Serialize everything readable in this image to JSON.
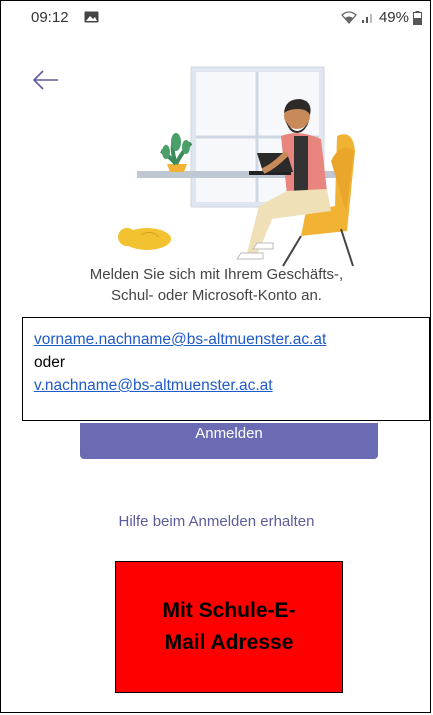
{
  "status_bar": {
    "time": "09:12",
    "battery": "49%",
    "icons": [
      "image-icon",
      "wifi-icon",
      "signal-icon",
      "battery-icon"
    ]
  },
  "screen": {
    "instruction_line1": "Melden Sie sich mit Ihrem Geschäfts-,",
    "instruction_line2": "Schul- oder Microsoft-Konto an.",
    "sign_in_button": "Anmelden",
    "help_link": "Hilfe beim Anmelden erhalten"
  },
  "callout": {
    "email_full": "vorname.nachname@bs-altmuenster.ac.at",
    "or_text": "oder",
    "email_short": "v.nachname@bs-altmuenster.ac.at"
  },
  "note_box": {
    "text": "Mit Schule-E-Mail Adresse"
  },
  "colors": {
    "accent": "#6b6bb3",
    "link": "#1f5ac8",
    "note_box": "#ff0000"
  }
}
